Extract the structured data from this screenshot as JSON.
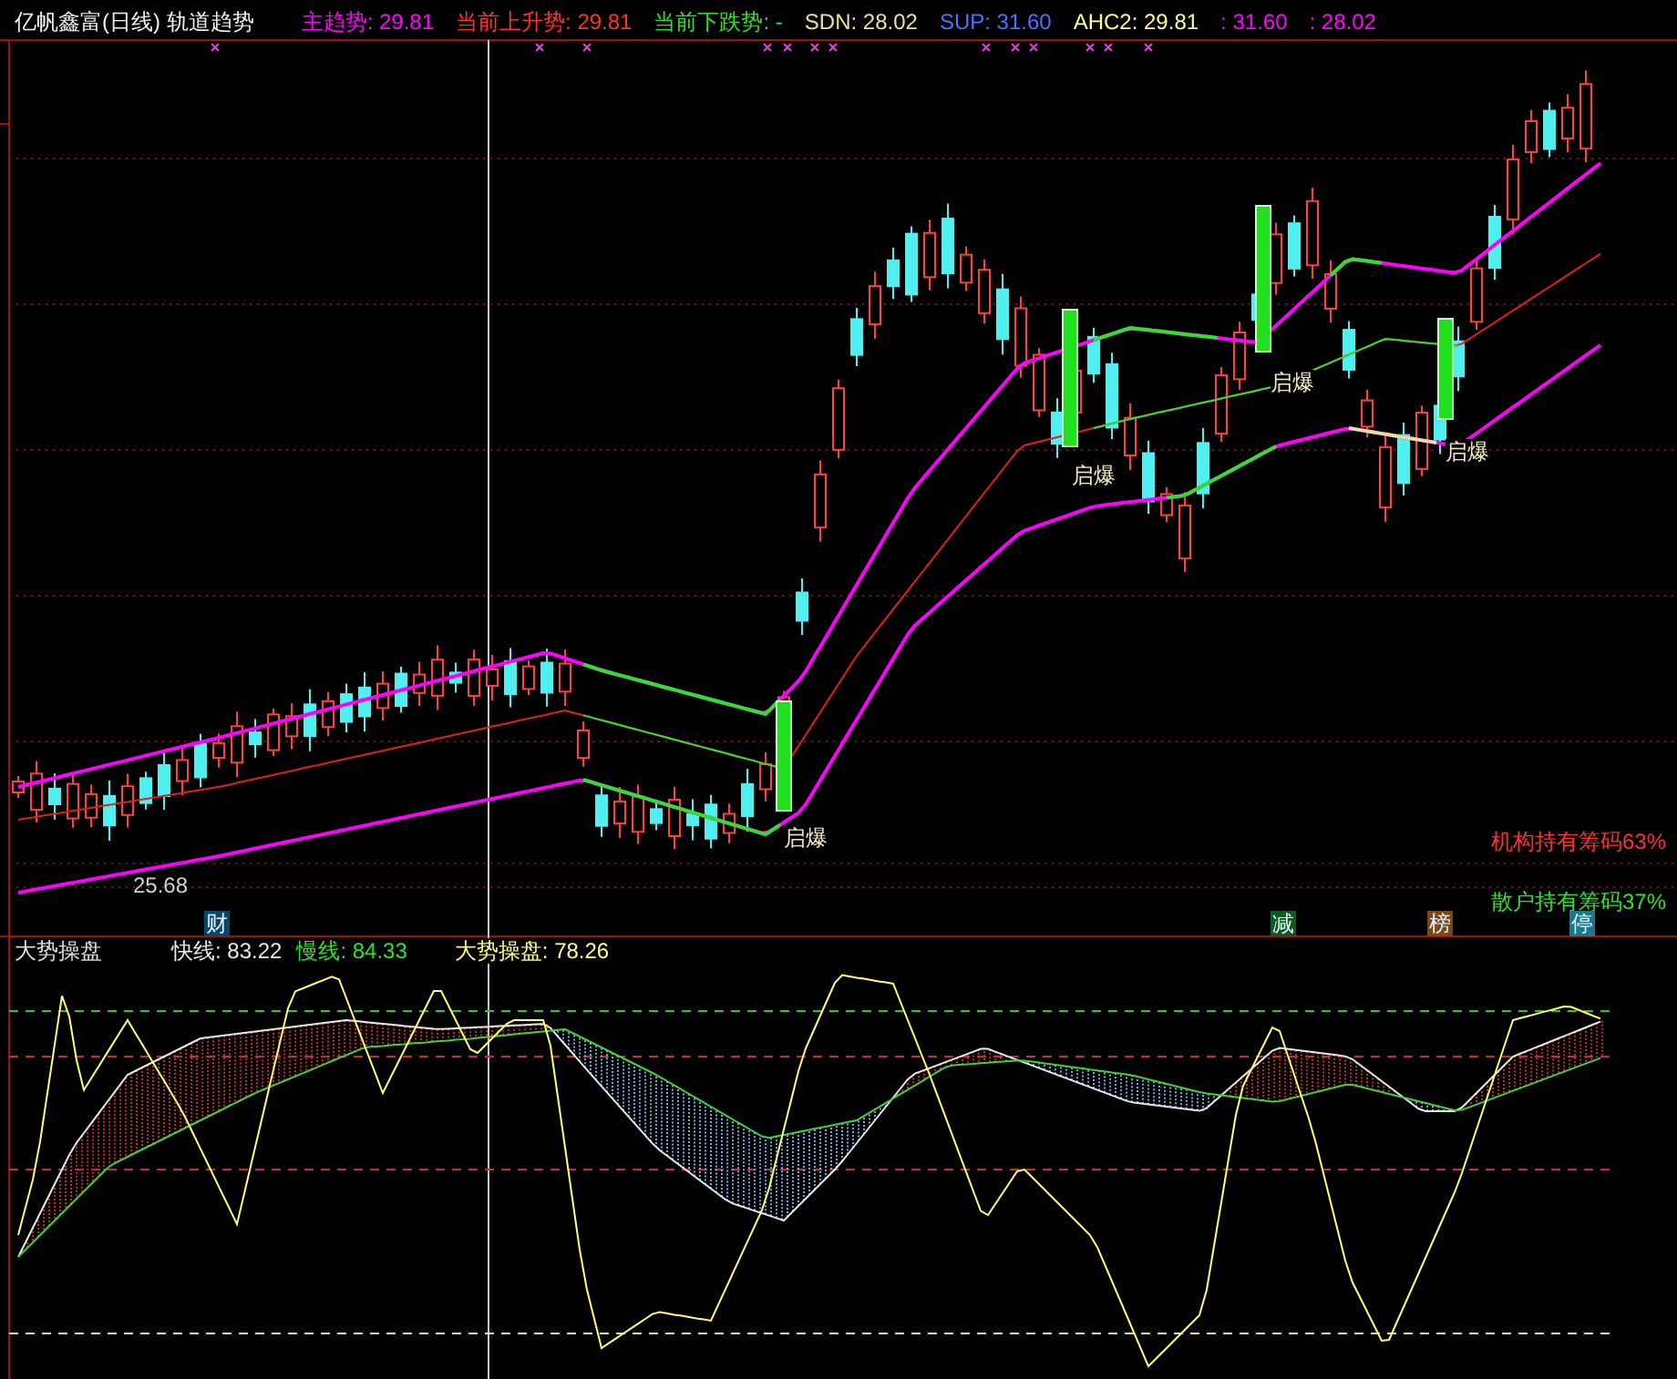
{
  "header": {
    "title": "亿帆鑫富(日线) 轨道趋势",
    "legend": [
      {
        "text": "主趋势: 29.81",
        "color": "#ff00ff"
      },
      {
        "text": "当前上升势: 29.81",
        "color": "#ff3030"
      },
      {
        "text": "当前下跌势: -",
        "color": "#30e030"
      },
      {
        "text": "SDN: 28.02",
        "color": "#e8e0a0"
      },
      {
        "text": "SUP: 31.60",
        "color": "#5070ff"
      },
      {
        "text": "AHC2: 29.81",
        "color": "#ffff90"
      },
      {
        "text": ": 31.60",
        "color": "#ff00ff"
      },
      {
        "text": ": 28.02",
        "color": "#ff00ff"
      }
    ]
  },
  "main_chart": {
    "signals": [
      "启爆",
      "启爆",
      "启爆",
      "启爆"
    ],
    "low_label": "25.68",
    "notes": [
      {
        "text": "机构持有筹码63%",
        "color": "#ff3030"
      },
      {
        "text": "散户持有筹码37%",
        "color": "#30e030"
      }
    ],
    "badges": [
      {
        "text": "财",
        "color": "#0a4868"
      },
      {
        "text": "减",
        "color": "#0e5a20"
      },
      {
        "text": "榜",
        "color": "#7a4818"
      },
      {
        "text": "停",
        "color": "#1a7a8a"
      }
    ]
  },
  "oscillator": {
    "title": "大势操盘",
    "legend": [
      {
        "text": "快线: 83.22",
        "color": "#e8e8e8"
      },
      {
        "text": "慢线: 84.33",
        "color": "#30e030"
      },
      {
        "text": "大势操盘: 78.26",
        "color": "#ffff80"
      }
    ]
  }
}
